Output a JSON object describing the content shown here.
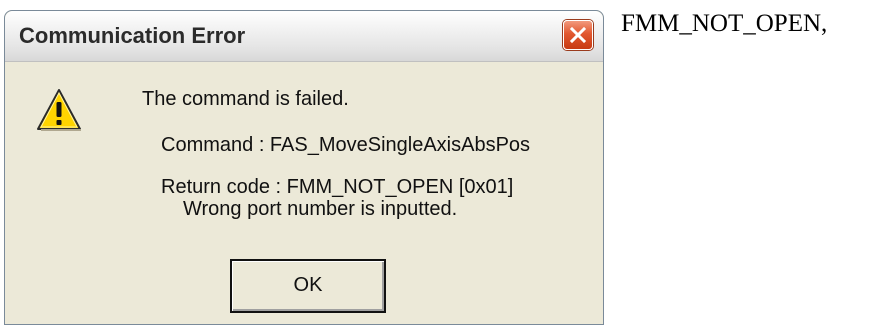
{
  "dialog": {
    "title": "Communication Error",
    "close_icon": "close-icon",
    "warning_icon": "warning-icon",
    "message": "The command is failed.",
    "command_line": "Command : FAS_MoveSingleAxisAbsPos",
    "return_code_line": "Return code : FMM_NOT_OPEN [0x01]",
    "description_line": "Wrong port number is inputted.",
    "ok_label": "OK",
    "colors": {
      "face": "#ece9d8",
      "close_button": "#e2572f",
      "warning_yellow": "#ffd400"
    }
  },
  "side_text": "FMM_NOT_OPEN,"
}
